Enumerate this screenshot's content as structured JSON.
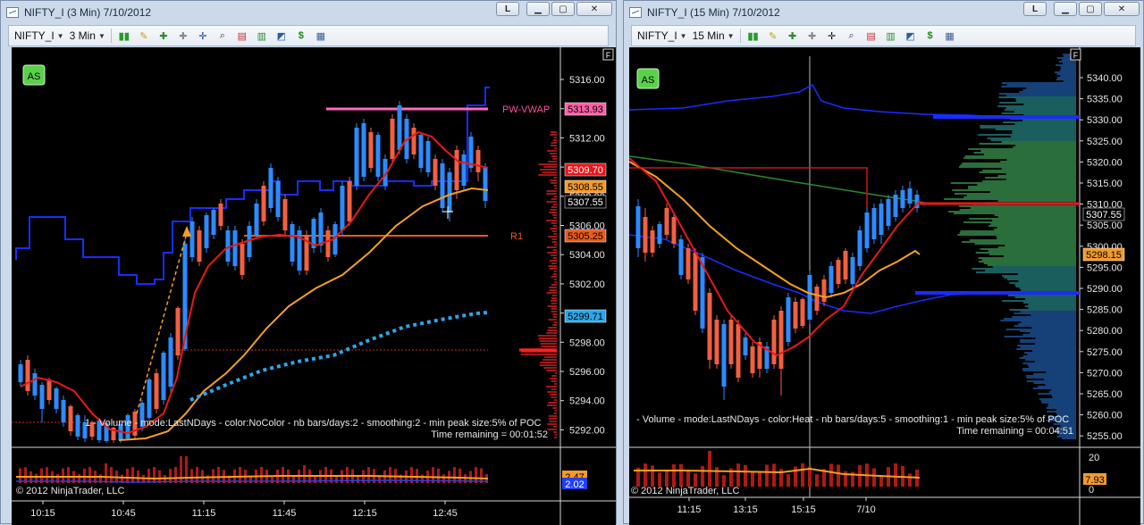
{
  "left": {
    "title": "NIFTY_I (3 Min)  7/10/2012",
    "instrument": "NIFTY_I",
    "interval": "3 Min",
    "as_badge": "AS",
    "f_marker": "F",
    "pwvwap_label": "PW-VWAP",
    "r1_label": "R1",
    "status_line": "1 - Volume - mode:LastNDays - color:NoColor - nb bars/days:2 - smoothing:2 - min peak size:5% of POC",
    "time_remaining": "Time remaining = 00:01:52",
    "copyright": "© 2012 NinjaTrader, LLC",
    "price_ticks": [
      "5316.00",
      "5314.00",
      "5312.00",
      "5310.00",
      "5308.00",
      "5306.00",
      "5304.00",
      "5302.00",
      "5300.00",
      "5298.00",
      "5296.00",
      "5294.00",
      "5292.00"
    ],
    "time_ticks": [
      "10:15",
      "10:45",
      "11:15",
      "11:45",
      "12:15",
      "12:45"
    ],
    "price_tags": [
      {
        "text": "5313.93",
        "bg": "#ff5fa8",
        "fg": "#000"
      },
      {
        "text": "5309.70",
        "bg": "#e8171b",
        "fg": "#fff"
      },
      {
        "text": "5308.55",
        "bg": "#f39a28",
        "fg": "#000"
      },
      {
        "text": "5307.55",
        "bg": "#000",
        "fg": "#fff"
      },
      {
        "text": "5305.25",
        "bg": "#e85b1a",
        "fg": "#000"
      },
      {
        "text": "5299.71",
        "bg": "#2aa7e8",
        "fg": "#000"
      }
    ],
    "vol_tags": [
      {
        "text": "2.47",
        "bg": "#f39a28"
      },
      {
        "text": "2.02",
        "bg": "#2040ff"
      }
    ]
  },
  "right": {
    "title": "NIFTY_I (15 Min)  7/10/2012",
    "instrument": "NIFTY_I",
    "interval": "15 Min",
    "as_badge": "AS",
    "f_marker": "F",
    "status_line": "- Volume - mode:LastNDays - color:Heat - nb bars/days:5 - smoothing:1 - min peak size:5% of POC",
    "time_remaining": "Time remaining = 00:04:51",
    "copyright": "© 2012 NinjaTrader, LLC",
    "price_ticks": [
      "5340.00",
      "5335.00",
      "5330.00",
      "5325.00",
      "5320.00",
      "5315.00",
      "5310.00",
      "5305.00",
      "5300.00",
      "5295.00",
      "5290.00",
      "5285.00",
      "5280.00",
      "5275.00",
      "5270.00",
      "5265.00",
      "5260.00",
      "5255.00"
    ],
    "time_ticks": [
      "11:15",
      "13:15",
      "15:15",
      "7/10"
    ],
    "price_tags": [
      {
        "text": "5307.55",
        "bg": "#000",
        "fg": "#fff"
      },
      {
        "text": "5298.15",
        "bg": "#f39a28",
        "fg": "#000"
      }
    ],
    "vol_ticks": [
      "20",
      "0"
    ],
    "vol_tag": {
      "text": "7.93",
      "bg": "#f39a28"
    }
  }
}
